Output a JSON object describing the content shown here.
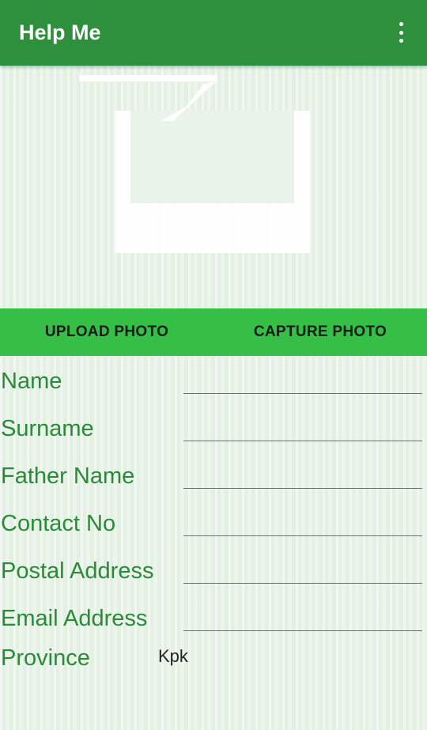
{
  "appbar": {
    "title": "Help Me",
    "menu_icon": "overflow-menu-icon"
  },
  "photo": {
    "placeholder_icon": "image-placeholder-icon"
  },
  "photo_actions": {
    "upload_label": "UPLOAD PHOTO",
    "capture_label": "CAPTURE PHOTO"
  },
  "form": {
    "name_label": "Name",
    "surname_label": "Surname",
    "father_name_label": "Father Name",
    "contact_label": "Contact No",
    "postal_label": "Postal Address",
    "email_label": "Email Address",
    "province_label": "Province",
    "province_value": "Kpk"
  },
  "colors": {
    "appbar": "#2e8f3d",
    "action_bar": "#35bf46",
    "label": "#2a8a38"
  }
}
